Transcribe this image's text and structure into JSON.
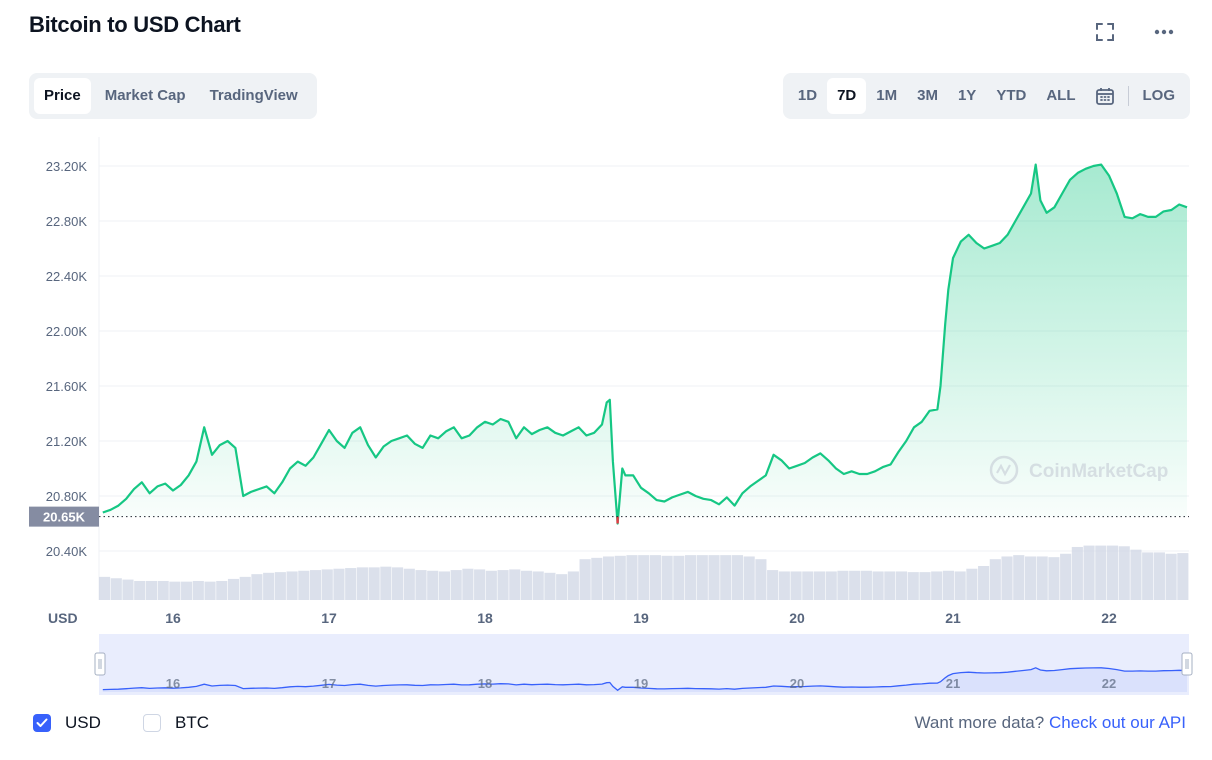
{
  "header": {
    "title": "Bitcoin to USD Chart",
    "fullscreen_icon": "fullscreen-icon",
    "more_icon": "more-icon"
  },
  "tabs": [
    {
      "label": "Price",
      "active": true
    },
    {
      "label": "Market Cap",
      "active": false
    },
    {
      "label": "TradingView",
      "active": false
    }
  ],
  "ranges": [
    {
      "label": "1D",
      "active": false
    },
    {
      "label": "7D",
      "active": true
    },
    {
      "label": "1M",
      "active": false
    },
    {
      "label": "3M",
      "active": false
    },
    {
      "label": "1Y",
      "active": false
    },
    {
      "label": "YTD",
      "active": false
    },
    {
      "label": "ALL",
      "active": false
    }
  ],
  "calendar_icon": "calendar-icon",
  "log_label": "LOG",
  "colors": {
    "up": "#16c784",
    "down": "#ea3943",
    "accent": "#3861fb",
    "volume": "#cfd6e4",
    "navigator_line": "#3861fb"
  },
  "chart_data": {
    "type": "area",
    "ylabel": "",
    "currency_label": "USD",
    "y_ticks": [
      "23.20K",
      "22.80K",
      "22.40K",
      "22.00K",
      "21.60K",
      "21.20K",
      "20.80K",
      "20.40K"
    ],
    "y_tick_values": [
      23200,
      22800,
      22400,
      22000,
      21600,
      21200,
      20800,
      20400
    ],
    "x_ticks": [
      "16",
      "17",
      "18",
      "19",
      "20",
      "21",
      "22"
    ],
    "x_tick_values": [
      16,
      17,
      18,
      19,
      20,
      21,
      22
    ],
    "baseline_value": 20650,
    "baseline_label": "20.65K",
    "watermark": "CoinMarketCap",
    "series": [
      {
        "x": [
          15.55,
          15.6,
          15.65,
          15.7,
          15.75,
          15.8,
          15.85,
          15.9,
          15.95,
          16.0,
          16.05,
          16.1,
          16.15,
          16.2,
          16.25,
          16.3,
          16.35,
          16.4,
          16.45,
          16.5,
          16.55,
          16.6,
          16.65,
          16.7,
          16.75,
          16.8,
          16.85,
          16.9,
          16.95,
          17.0,
          17.05,
          17.1,
          17.15,
          17.2,
          17.25,
          17.3,
          17.35,
          17.4,
          17.45,
          17.5,
          17.55,
          17.6,
          17.65,
          17.7,
          17.75,
          17.8,
          17.85,
          17.9,
          17.95,
          18.0,
          18.05,
          18.1,
          18.15,
          18.2,
          18.25,
          18.3,
          18.35,
          18.4,
          18.45,
          18.5,
          18.55,
          18.6,
          18.65,
          18.7,
          18.75,
          18.78,
          18.8,
          18.82,
          18.85,
          18.88,
          18.9,
          18.95,
          19.0,
          19.05,
          19.1,
          19.15,
          19.2,
          19.25,
          19.3,
          19.35,
          19.4,
          19.45,
          19.5,
          19.55,
          19.6,
          19.65,
          19.7,
          19.75,
          19.8,
          19.85,
          19.9,
          19.95,
          20.0,
          20.05,
          20.1,
          20.15,
          20.2,
          20.25,
          20.3,
          20.35,
          20.4,
          20.45,
          20.5,
          20.55,
          20.6,
          20.65,
          20.7,
          20.75,
          20.8,
          20.85,
          20.9,
          20.92,
          20.95,
          20.97,
          21.0,
          21.05,
          21.1,
          21.15,
          21.2,
          21.25,
          21.3,
          21.35,
          21.4,
          21.45,
          21.5,
          21.53,
          21.56,
          21.6,
          21.65,
          21.7,
          21.75,
          21.8,
          21.85,
          21.9,
          21.95,
          22.0,
          22.05,
          22.1,
          22.15,
          22.2,
          22.25,
          22.3,
          22.35,
          22.4,
          22.45,
          22.5
        ],
        "y": [
          20680,
          20700,
          20730,
          20780,
          20850,
          20900,
          20820,
          20870,
          20890,
          20840,
          20880,
          20950,
          21050,
          21300,
          21100,
          21170,
          21200,
          21150,
          20800,
          20830,
          20850,
          20870,
          20820,
          20900,
          21000,
          21050,
          21020,
          21080,
          21180,
          21280,
          21200,
          21150,
          21260,
          21300,
          21170,
          21080,
          21160,
          21200,
          21220,
          21240,
          21180,
          21150,
          21240,
          21220,
          21270,
          21300,
          21220,
          21240,
          21300,
          21340,
          21320,
          21360,
          21340,
          21220,
          21300,
          21250,
          21280,
          21300,
          21260,
          21240,
          21270,
          21300,
          21240,
          21260,
          21320,
          21480,
          21500,
          21050,
          20600,
          21000,
          20950,
          20950,
          20860,
          20820,
          20770,
          20760,
          20790,
          20810,
          20830,
          20800,
          20780,
          20770,
          20740,
          20790,
          20730,
          20820,
          20870,
          20910,
          20950,
          21100,
          21060,
          21000,
          21020,
          21040,
          21080,
          21110,
          21060,
          21000,
          20960,
          20980,
          20960,
          20960,
          20980,
          21010,
          21030,
          21120,
          21200,
          21300,
          21340,
          21420,
          21430,
          21600,
          22050,
          22300,
          22530,
          22650,
          22700,
          22640,
          22600,
          22620,
          22640,
          22700,
          22800,
          22900,
          23000,
          23210,
          22950,
          22860,
          22900,
          23000,
          23100,
          23150,
          23180,
          23200,
          23210,
          23130,
          23000,
          22830,
          22820,
          22850,
          22830,
          22830,
          22870,
          22880,
          22920,
          22900
        ]
      }
    ],
    "volume_relative": [
      0.34,
      0.32,
      0.3,
      0.28,
      0.28,
      0.28,
      0.27,
      0.27,
      0.28,
      0.27,
      0.28,
      0.31,
      0.34,
      0.38,
      0.4,
      0.41,
      0.42,
      0.43,
      0.44,
      0.45,
      0.46,
      0.47,
      0.48,
      0.48,
      0.49,
      0.48,
      0.46,
      0.44,
      0.43,
      0.42,
      0.44,
      0.46,
      0.45,
      0.43,
      0.44,
      0.45,
      0.43,
      0.42,
      0.4,
      0.38,
      0.42,
      0.6,
      0.62,
      0.64,
      0.65,
      0.66,
      0.66,
      0.66,
      0.65,
      0.65,
      0.66,
      0.66,
      0.66,
      0.66,
      0.66,
      0.64,
      0.6,
      0.44,
      0.42,
      0.42,
      0.42,
      0.42,
      0.42,
      0.43,
      0.43,
      0.43,
      0.42,
      0.42,
      0.42,
      0.41,
      0.41,
      0.42,
      0.43,
      0.42,
      0.46,
      0.5,
      0.6,
      0.64,
      0.66,
      0.64,
      0.64,
      0.63,
      0.68,
      0.78,
      0.8,
      0.8,
      0.8,
      0.79,
      0.74,
      0.7,
      0.7,
      0.68,
      0.69
    ]
  },
  "navigator": {
    "x_ticks": [
      "16",
      "17",
      "18",
      "19",
      "20",
      "21",
      "22"
    ]
  },
  "footer": {
    "usd_label": "USD",
    "usd_checked": true,
    "btc_label": "BTC",
    "btc_checked": false,
    "more_data_text": "Want more data?",
    "api_link_text": "Check out our API"
  }
}
